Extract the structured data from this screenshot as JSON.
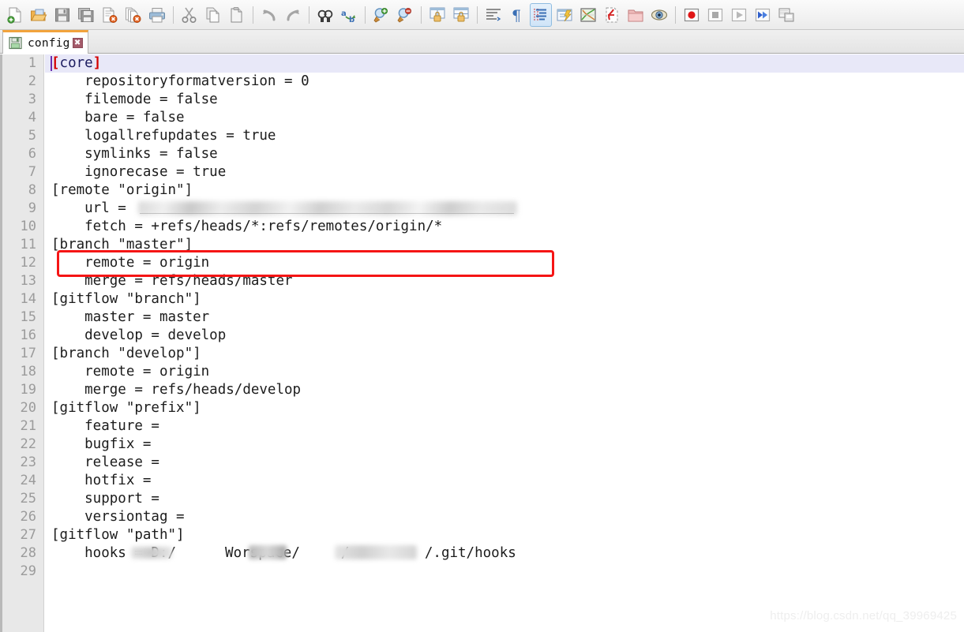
{
  "toolbar": {
    "groups": [
      {
        "buttons": [
          {
            "name": "new-file-button",
            "label": "New"
          },
          {
            "name": "open-file-button",
            "label": "Open"
          },
          {
            "name": "save-button",
            "label": "Save"
          },
          {
            "name": "save-all-button",
            "label": "Save All"
          },
          {
            "name": "close-button",
            "label": "Close"
          },
          {
            "name": "close-all-button",
            "label": "Close All"
          },
          {
            "name": "print-button",
            "label": "Print"
          }
        ]
      },
      {
        "buttons": [
          {
            "name": "cut-button",
            "label": "Cut"
          },
          {
            "name": "copy-button",
            "label": "Copy"
          },
          {
            "name": "paste-button",
            "label": "Paste"
          }
        ]
      },
      {
        "buttons": [
          {
            "name": "undo-button",
            "label": "Undo"
          },
          {
            "name": "redo-button",
            "label": "Redo"
          }
        ]
      },
      {
        "buttons": [
          {
            "name": "find-button",
            "label": "Find"
          },
          {
            "name": "replace-button",
            "label": "Replace"
          }
        ]
      },
      {
        "buttons": [
          {
            "name": "zoom-in-button",
            "label": "Zoom In"
          },
          {
            "name": "zoom-out-button",
            "label": "Zoom Out"
          }
        ]
      },
      {
        "buttons": [
          {
            "name": "sync-vertical-scroll-button",
            "label": "Synchronize Vertical Scrolling"
          },
          {
            "name": "sync-horizontal-scroll-button",
            "label": "Synchronize Horizontal Scrolling"
          }
        ]
      },
      {
        "buttons": [
          {
            "name": "word-wrap-button",
            "label": "Word Wrap"
          },
          {
            "name": "show-all-characters-button",
            "label": "Show All Characters"
          },
          {
            "name": "indent-guide-button",
            "label": "Show Indent Guide",
            "active": true
          },
          {
            "name": "user-define-dialog-button",
            "label": "User Defined Dialogue"
          },
          {
            "name": "document-map-button",
            "label": "Document Map"
          },
          {
            "name": "function-list-button",
            "label": "Function List"
          },
          {
            "name": "folder-as-workspace-button",
            "label": "Folder as Workspace"
          },
          {
            "name": "monitoring-button",
            "label": "Monitoring"
          }
        ]
      },
      {
        "buttons": [
          {
            "name": "record-macro-button",
            "label": "Start Recording"
          },
          {
            "name": "stop-recording-button",
            "label": "Stop Recording"
          },
          {
            "name": "play-macro-button",
            "label": "Playback"
          },
          {
            "name": "run-macro-multiple-button",
            "label": "Run a Macro Multiple Times"
          },
          {
            "name": "save-macro-button",
            "label": "Save Current Recorded Macro"
          }
        ]
      }
    ]
  },
  "tab": {
    "label": "config",
    "close_glyph": "✖",
    "save_icon": "floppy-disk-icon"
  },
  "editor": {
    "current_line": 1,
    "total_lines": 29,
    "line_numbers": [
      1,
      2,
      3,
      4,
      5,
      6,
      7,
      8,
      9,
      10,
      11,
      12,
      13,
      14,
      15,
      16,
      17,
      18,
      19,
      20,
      21,
      22,
      23,
      24,
      25,
      26,
      27,
      28,
      29
    ],
    "lines": [
      {
        "n": 1,
        "indent": "",
        "pre": "[",
        "mid": "core",
        "post": "]",
        "type": "section"
      },
      {
        "n": 2,
        "text": "    repositoryformatversion = 0"
      },
      {
        "n": 3,
        "text": "    filemode = false"
      },
      {
        "n": 4,
        "text": "    bare = false"
      },
      {
        "n": 5,
        "text": "    logallrefupdates = true"
      },
      {
        "n": 6,
        "text": "    symlinks = false"
      },
      {
        "n": 7,
        "text": "    ignorecase = true"
      },
      {
        "n": 8,
        "text": "[remote \"origin\"]"
      },
      {
        "n": 9,
        "text": "    url = ",
        "redacted": true
      },
      {
        "n": 10,
        "text": "    fetch = +refs/heads/*:refs/remotes/origin/*"
      },
      {
        "n": 11,
        "text": "[branch \"master\"]"
      },
      {
        "n": 12,
        "text": "    remote = origin"
      },
      {
        "n": 13,
        "text": "    merge = refs/heads/master"
      },
      {
        "n": 14,
        "text": "[gitflow \"branch\"]"
      },
      {
        "n": 15,
        "text": "    master = master"
      },
      {
        "n": 16,
        "text": "    develop = develop"
      },
      {
        "n": 17,
        "text": "[branch \"develop\"]"
      },
      {
        "n": 18,
        "text": "    remote = origin"
      },
      {
        "n": 19,
        "text": "    merge = refs/heads/develop"
      },
      {
        "n": 20,
        "text": "[gitflow \"prefix\"]"
      },
      {
        "n": 21,
        "text": "    feature ="
      },
      {
        "n": 22,
        "text": "    bugfix ="
      },
      {
        "n": 23,
        "text": "    release ="
      },
      {
        "n": 24,
        "text": "    hotfix ="
      },
      {
        "n": 25,
        "text": "    support ="
      },
      {
        "n": 26,
        "text": "    versiontag ="
      },
      {
        "n": 27,
        "text": "[gitflow \"path\"]"
      },
      {
        "n": 28,
        "text": "    hooks = D:/",
        "mid2": "Worspace/",
        "tail": "/.git/hooks",
        "redacted_path": true
      },
      {
        "n": 29,
        "text": ""
      }
    ]
  },
  "annotation": {
    "name": "red-highlight-rectangle",
    "target_line": 9,
    "color": "#f51515"
  },
  "watermark": {
    "text": "https://blog.csdn.net/qq_39969425"
  },
  "colors": {
    "tab_accent": "#f2a33c",
    "section_bracket": "#d40000",
    "current_line_highlight": "#e8e8f8",
    "gutter_bg": "#e8e8e8",
    "line_number": "#9b9b9b",
    "caret": "#6a2fb0"
  }
}
